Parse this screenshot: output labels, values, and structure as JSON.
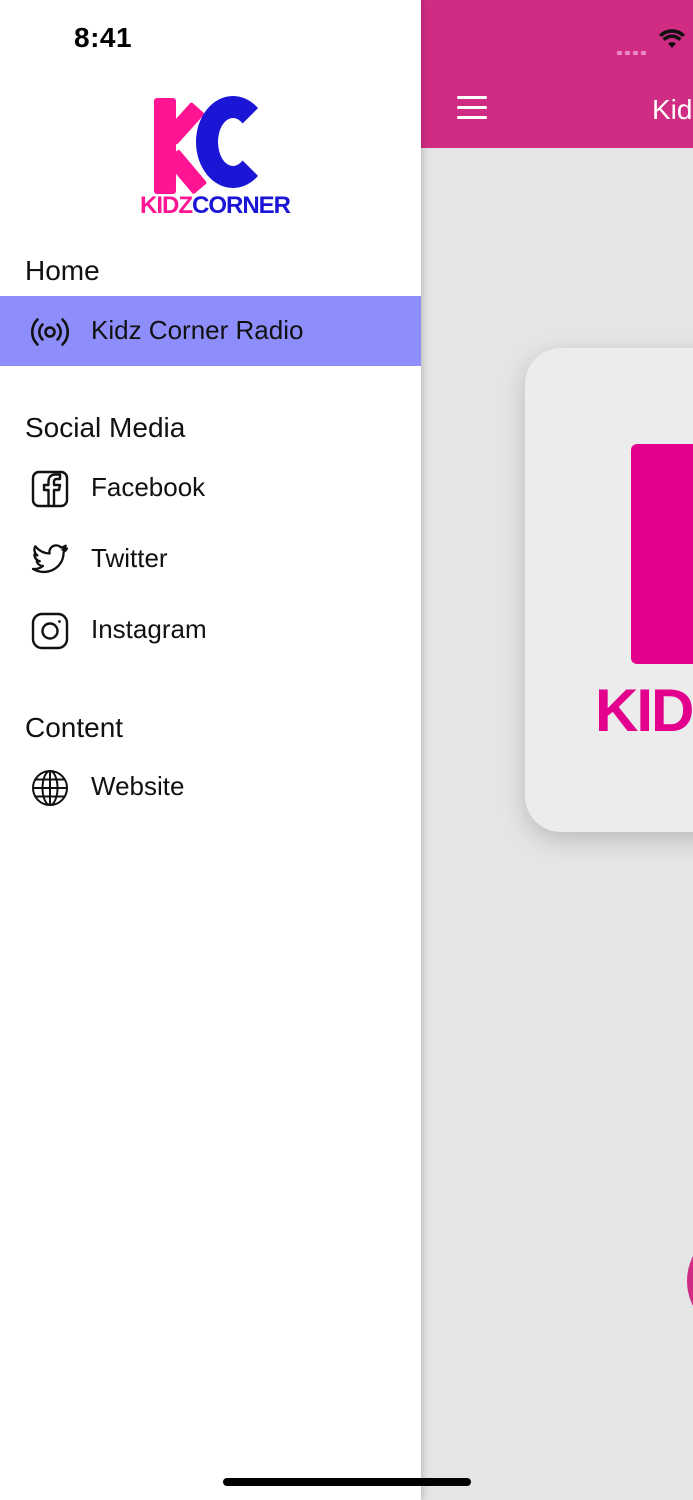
{
  "status": {
    "time": "8:41"
  },
  "main": {
    "title": "Kidz Corner Radio",
    "card_logo_text": "KIDZ"
  },
  "drawer": {
    "logo": {
      "word_left": "KIDZ",
      "word_right": "CORNER"
    },
    "sections": [
      {
        "title": "Home",
        "items": [
          {
            "label": "Kidz Corner Radio",
            "icon": "radio-broadcast-icon",
            "active": true
          }
        ]
      },
      {
        "title": "Social Media",
        "items": [
          {
            "label": "Facebook",
            "icon": "facebook-icon"
          },
          {
            "label": "Twitter",
            "icon": "twitter-icon"
          },
          {
            "label": "Instagram",
            "icon": "instagram-icon"
          }
        ]
      },
      {
        "title": "Content",
        "items": [
          {
            "label": "Website",
            "icon": "globe-icon"
          }
        ]
      }
    ]
  },
  "colors": {
    "header": "#d02c84",
    "active_item": "#8d8dfb",
    "logo_pink": "#ff1493",
    "logo_blue": "#1b15d6"
  }
}
